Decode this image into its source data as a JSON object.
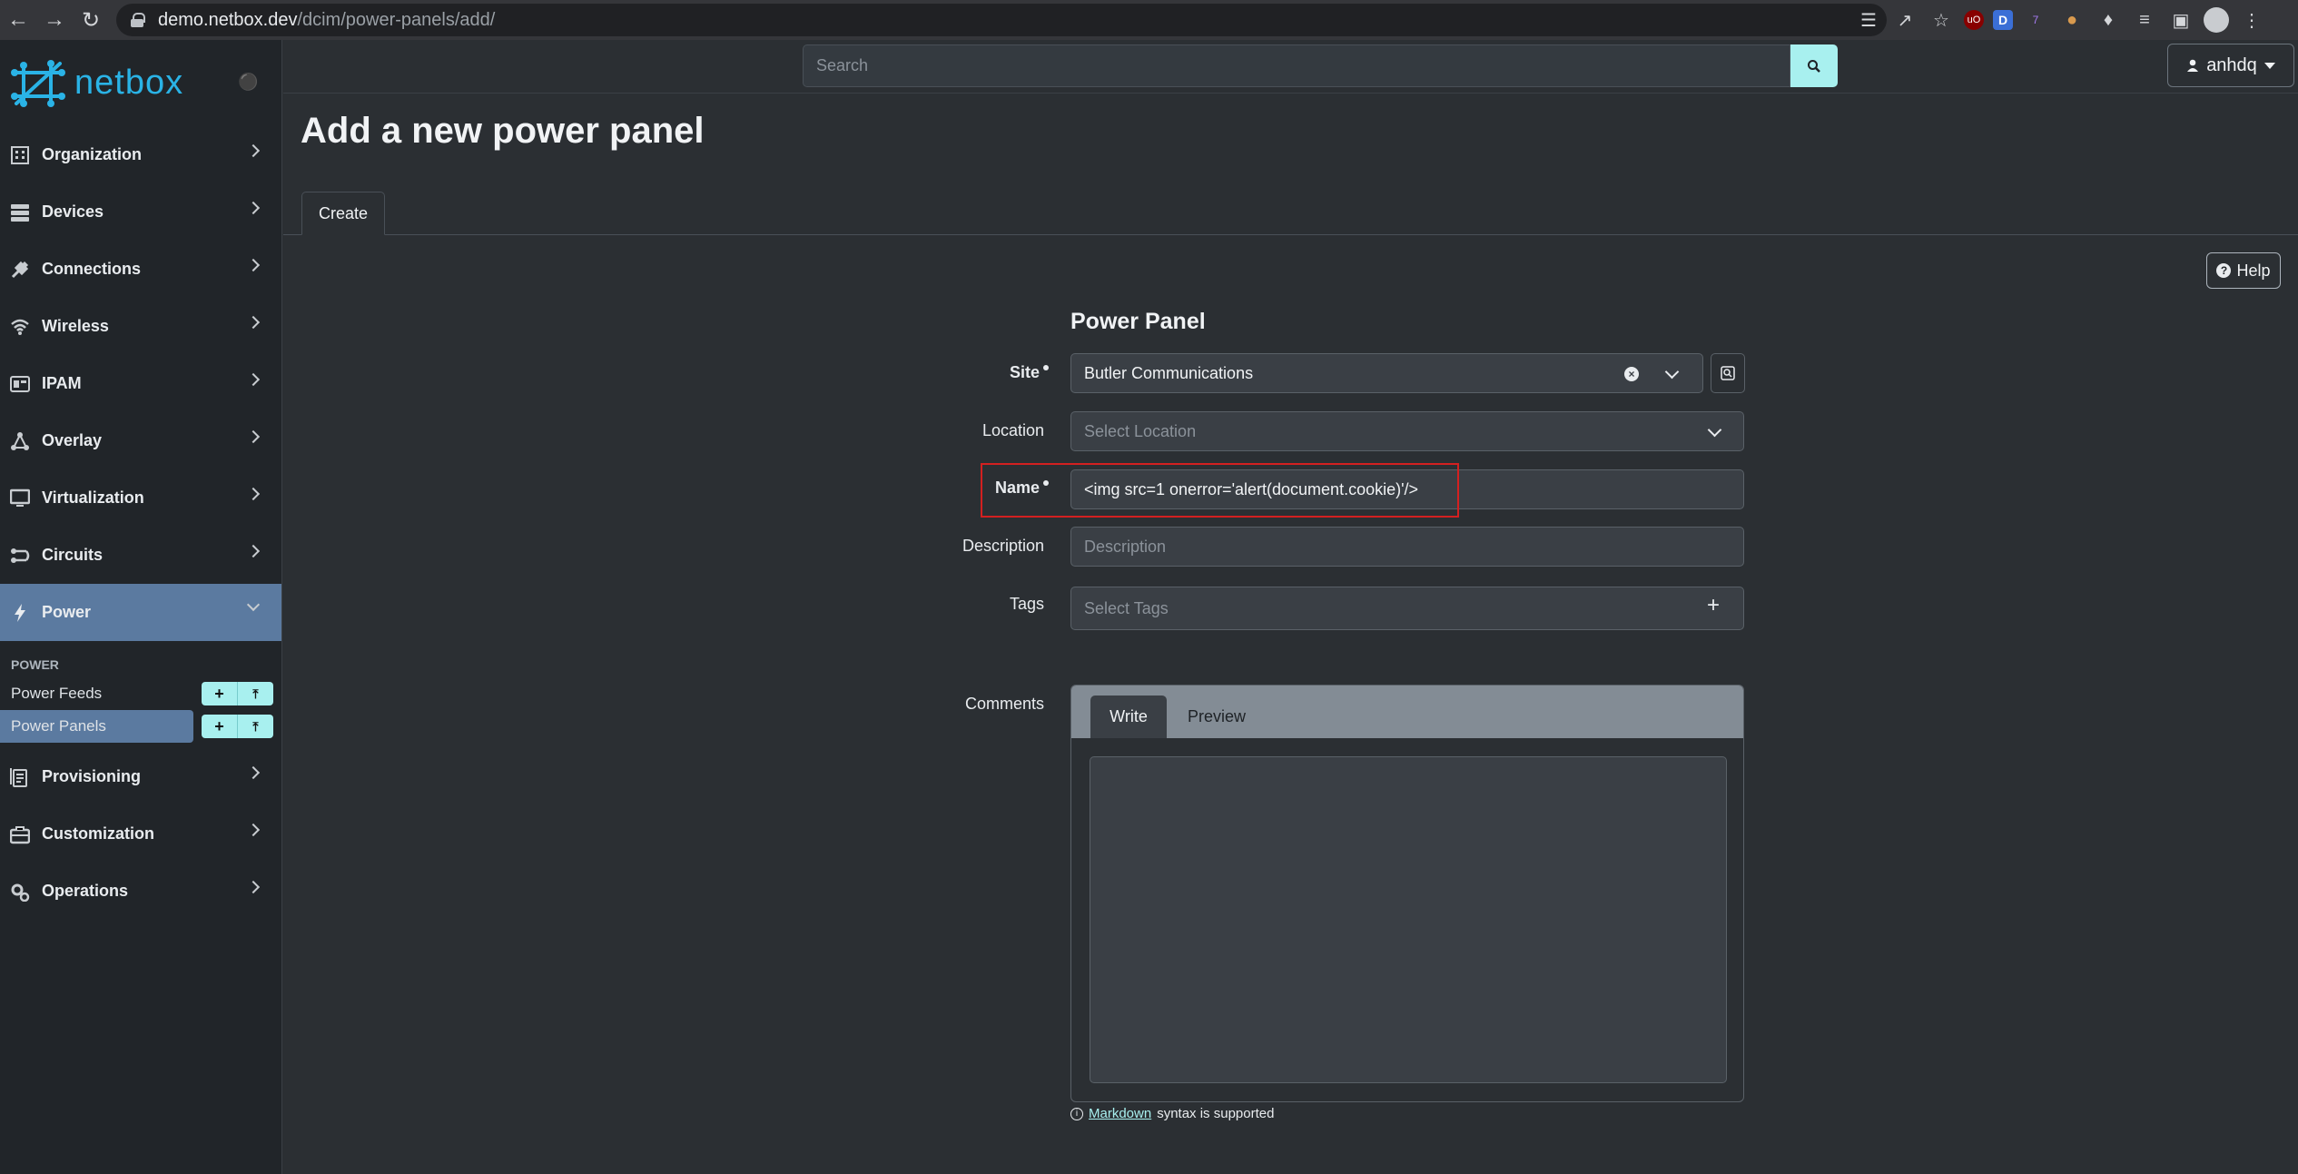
{
  "browser": {
    "url_host": "demo.netbox.dev",
    "url_path": "/dcim/power-panels/add/",
    "ext_badge": "7"
  },
  "brand": {
    "name": "netbox"
  },
  "topbar": {
    "search_placeholder": "Search",
    "username": "anhdq"
  },
  "sidebar": {
    "items": [
      {
        "label": "Organization"
      },
      {
        "label": "Devices"
      },
      {
        "label": "Connections"
      },
      {
        "label": "Wireless"
      },
      {
        "label": "IPAM"
      },
      {
        "label": "Overlay"
      },
      {
        "label": "Virtualization"
      },
      {
        "label": "Circuits"
      },
      {
        "label": "Power"
      },
      {
        "label": "Provisioning"
      },
      {
        "label": "Customization"
      },
      {
        "label": "Operations"
      }
    ],
    "power_group_heading": "POWER",
    "power_sub": [
      {
        "label": "Power Feeds"
      },
      {
        "label": "Power Panels"
      }
    ]
  },
  "page": {
    "title": "Add a new power panel",
    "tab_create": "Create",
    "help_label": "Help",
    "section_title": "Power Panel"
  },
  "form": {
    "site_label": "Site",
    "site_value": "Butler Communications",
    "location_label": "Location",
    "location_placeholder": "Select Location",
    "name_label": "Name",
    "name_value": "<img src=1 onerror='alert(document.cookie)'/>",
    "description_label": "Description",
    "description_placeholder": "Description",
    "tags_label": "Tags",
    "tags_placeholder": "Select Tags",
    "comments_label": "Comments",
    "write_tab": "Write",
    "preview_tab": "Preview",
    "markdown_link": "Markdown",
    "markdown_suffix": "syntax is supported"
  },
  "colors": {
    "accent": "#a8f0ef",
    "brand": "#2ab3e6",
    "sidebar_active": "#5b7aa0",
    "highlight_border": "#d32020"
  }
}
